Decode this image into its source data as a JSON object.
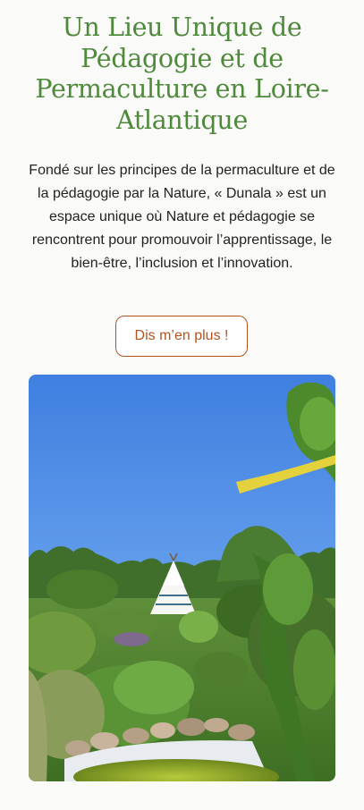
{
  "hero": {
    "title": "Un Lieu Unique de Pédagogie et de Permaculture en Loire-Atlantique",
    "description": "Fondé sur les principes de la permaculture et de la pédagogie par la Nature, « Dunala » est un espace unique où Nature et pédagogie se rencontrent pour promouvoir l’apprentissage, le bien-être, l’inclusion et l’innovation.",
    "cta_label": "Dis m’en plus !"
  },
  "image": {
    "subject": "garden-photo-tipi-pond"
  },
  "colors": {
    "title_green": "#4f8a3c",
    "accent_orange": "#b4531f",
    "body_text": "#222222",
    "background": "#fafaf8"
  }
}
